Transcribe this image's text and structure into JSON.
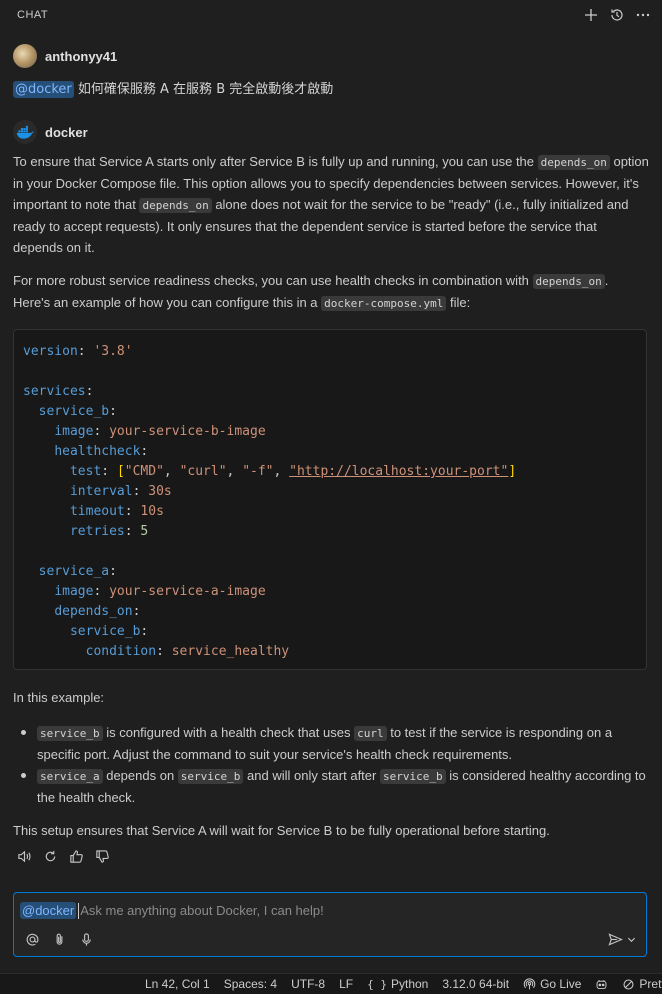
{
  "header": {
    "title": "CHAT"
  },
  "user": {
    "name": "anthonyy41",
    "mention": "@docker",
    "message": " 如何確保服務 A 在服務 B 完全啟動後才啟動"
  },
  "bot": {
    "name": "docker"
  },
  "response": {
    "p1": {
      "t1": "To ensure that Service A starts only after Service B is fully up and running, you can use the ",
      "c1": "depends_on",
      "t2": " option in your Docker Compose file. This option allows you to specify dependencies between services. However, it's important to note that ",
      "c2": "depends_on",
      "t3": " alone does not wait for the service to be \"ready\" (i.e., fully initialized and ready to accept requests). It only ensures that the dependent service is started before the service that depends on it."
    },
    "p2": {
      "t1": "For more robust service readiness checks, you can use health checks in combination with ",
      "c1": "depends_on",
      "t2": ". Here's an example of how you can configure this in a ",
      "c2": "docker-compose.yml",
      "t3": " file:"
    },
    "code": {
      "version_key": "version",
      "version_val": "'3.8'",
      "services_key": "services",
      "service_b_key": "service_b",
      "image_key": "image",
      "image_b_val": "your-service-b-image",
      "healthcheck_key": "healthcheck",
      "test_key": "test",
      "test_cmd": "\"CMD\"",
      "test_curl": "\"curl\"",
      "test_f": "\"-f\"",
      "test_url": "\"http://localhost:your-port\"",
      "interval_key": "interval",
      "interval_val": "30s",
      "timeout_key": "timeout",
      "timeout_val": "10s",
      "retries_key": "retries",
      "retries_val": "5",
      "service_a_key": "service_a",
      "image_a_val": "your-service-a-image",
      "depends_on_key": "depends_on",
      "service_b_ref": "service_b",
      "condition_key": "condition",
      "condition_val": "service_healthy"
    },
    "p3": "In this example:",
    "bullet1": {
      "c1": "service_b",
      "t1": " is configured with a health check that uses ",
      "c2": "curl",
      "t2": " to test if the service is responding on a specific port. Adjust the command to suit your service's health check requirements."
    },
    "bullet2": {
      "c1": "service_a",
      "t1": " depends on ",
      "c2": "service_b",
      "t2": " and will only start after ",
      "c3": "service_b",
      "t3": " is considered healthy according to the health check."
    },
    "p4": "This setup ensures that Service A will wait for Service B to be fully operational before starting."
  },
  "input": {
    "mention": "@docker",
    "placeholder": "Ask me anything about Docker, I can help!"
  },
  "status": {
    "position": "Ln 42, Col 1",
    "spaces": "Spaces: 4",
    "encoding": "UTF-8",
    "eol": "LF",
    "language": "Python",
    "interpreter": "3.12.0 64-bit",
    "golive": "Go Live",
    "prettier": "Prettie"
  }
}
